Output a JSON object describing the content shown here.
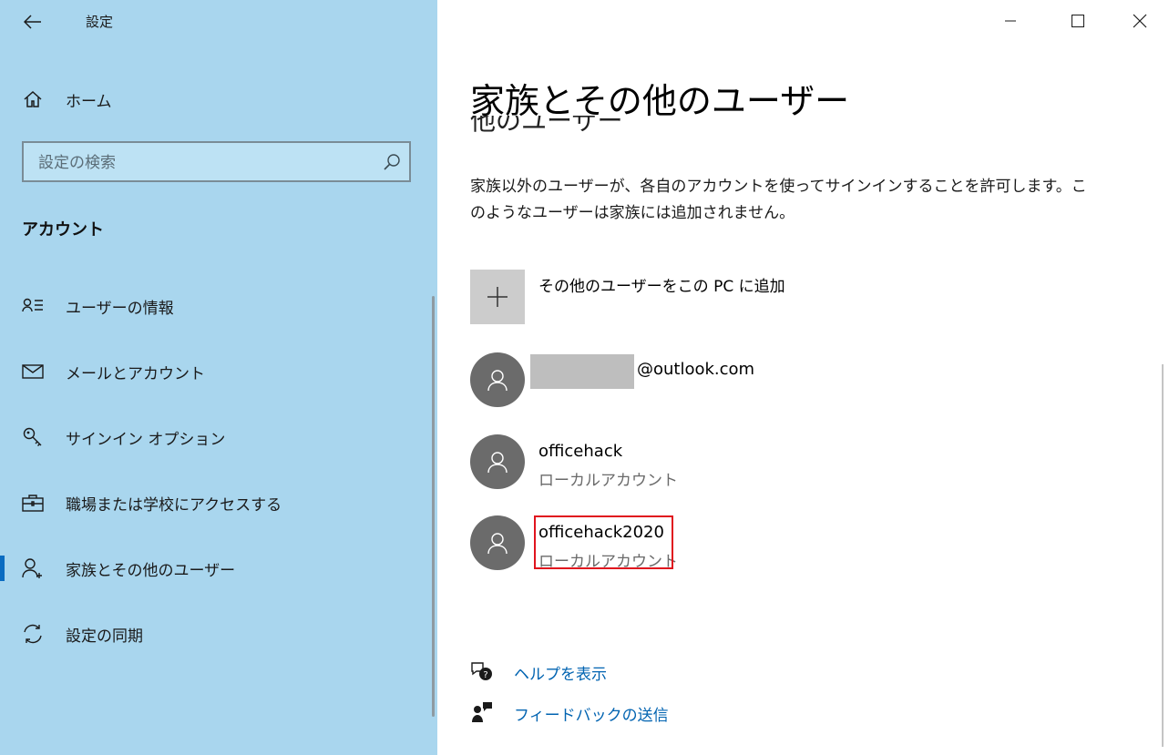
{
  "app": {
    "title": "設定"
  },
  "sidebar": {
    "home_label": "ホーム",
    "search_placeholder": "設定の検索",
    "section_title": "アカウント",
    "items": [
      {
        "label": "ユーザーの情報",
        "icon": "user-info-icon"
      },
      {
        "label": "メールとアカウント",
        "icon": "mail-icon"
      },
      {
        "label": "サインイン オプション",
        "icon": "key-icon"
      },
      {
        "label": "職場または学校にアクセスする",
        "icon": "briefcase-icon"
      },
      {
        "label": "家族とその他のユーザー",
        "icon": "add-person-icon",
        "active": true
      },
      {
        "label": "設定の同期",
        "icon": "sync-icon"
      }
    ]
  },
  "main": {
    "title": "家族とその他のユーザー",
    "partial_heading": "他のユーザー",
    "description": "家族以外のユーザーが、各自のアカウントを使ってサインインすることを許可します。このようなユーザーは家族には追加されません。",
    "add_user_label": "その他のユーザーをこの PC に追加",
    "users": [
      {
        "name": "@outlook.com",
        "type": ""
      },
      {
        "name": "officehack",
        "type": "ローカルアカウント"
      },
      {
        "name": "officehack2020",
        "type": "ローカルアカウント"
      }
    ],
    "links": [
      {
        "label": "ヘルプを表示",
        "icon": "help-chat-icon"
      },
      {
        "label": "フィードバックの送信",
        "icon": "feedback-icon"
      }
    ]
  },
  "colors": {
    "sidebar_bg": "#a9d6ee",
    "accent": "#0a6cc1",
    "link": "#0063b1",
    "highlight": "#e0141e"
  }
}
